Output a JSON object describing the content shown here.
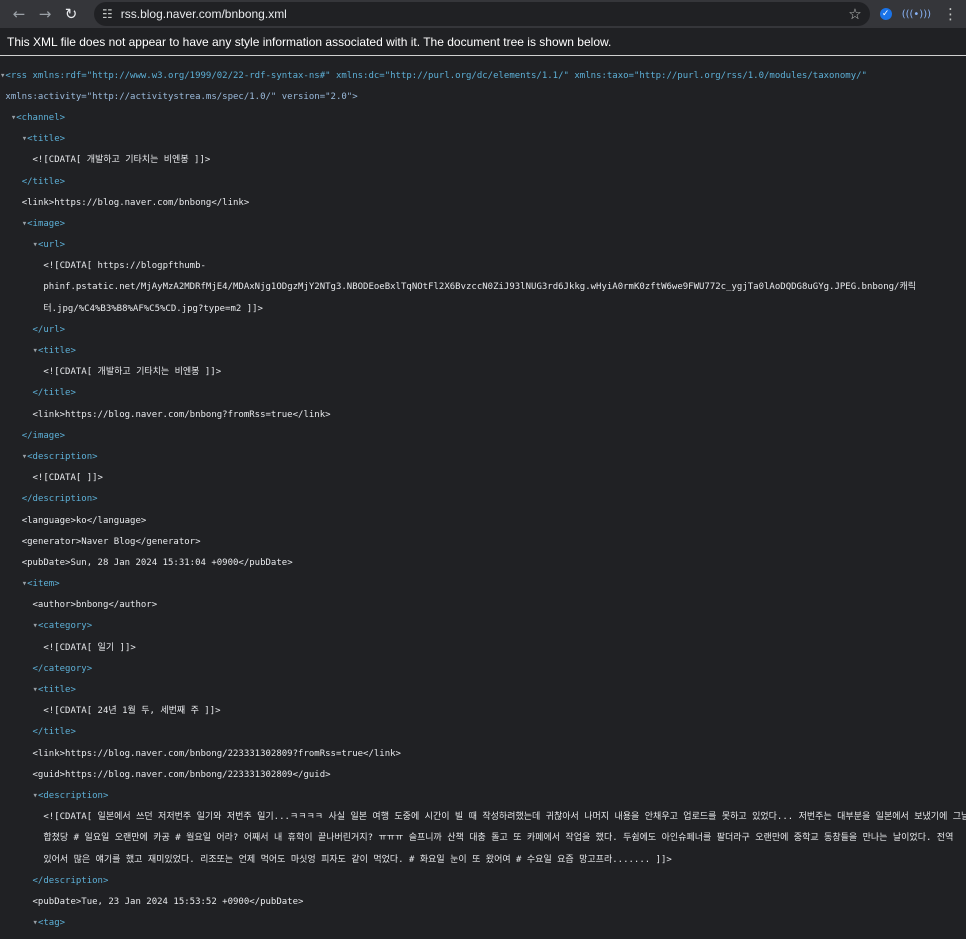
{
  "browser": {
    "url": "rss.blog.naver.com/bnbong.xml",
    "icons": [
      "back-icon",
      "forward-icon",
      "reload-icon",
      "site-info-icon",
      "star-icon",
      "extension-icon",
      "extension-icon",
      "menu-icon"
    ]
  },
  "notice": "This XML file does not appear to have any style information associated with it. The document tree is shown below.",
  "xml": {
    "rss_open_1": "<rss xmlns:rdf=\"http://www.w3.org/1999/02/22-rdf-syntax-ns#\" xmlns:dc=\"http://purl.org/dc/elements/1.1/\" xmlns:taxo=\"http://purl.org/rss/1.0/modules/taxonomy/\"",
    "rss_open_2": "xmlns:activity=\"http://activitystrea.ms/spec/1.0/\" version=\"2.0\">",
    "channel_open": "<channel>",
    "title_open": "<title>",
    "title_cdata": "<![CDATA[ 개발하고 기타치는 비엔봉 ]]>",
    "title_close": "</title>",
    "link": "<link>https://blog.naver.com/bnbong</link>",
    "image_open": "<image>",
    "url_open": "<url>",
    "url_cdata_1": "<![CDATA[ https://blogpfthumb-",
    "url_cdata_2": "phinf.pstatic.net/MjAyMzA2MDRfMjE4/MDAxNjg1ODgzMjY2NTg3.NBODEoeBxlTqNOtFl2X6BvzccN0ZiJ93lNUG3rd6Jkkg.wHyiA0rmK0zftW6we9FWU772c_ygjTa0lAoDQDG8uGYg.JPEG.bnbong/캐릭",
    "url_cdata_3": "터.jpg/%C4%B3%B8%AF%C5%CD.jpg?type=m2 ]]>",
    "url_close": "</url>",
    "image_title_open": "<title>",
    "image_title_cdata": "<![CDATA[ 개발하고 기타치는 비엔봉 ]]>",
    "image_title_close": "</title>",
    "image_link": "<link>https://blog.naver.com/bnbong?fromRss=true</link>",
    "image_close": "</image>",
    "description_open": "<description>",
    "description_cdata": "<![CDATA[ ]]>",
    "description_close": "</description>",
    "language": "<language>ko</language>",
    "generator": "<generator>Naver Blog</generator>",
    "pubdate": "<pubDate>Sun, 28 Jan 2024 15:31:04 +0900</pubDate>",
    "item_open": "<item>",
    "author": "<author>bnbong</author>",
    "category_open": "<category>",
    "category_cdata": "<![CDATA[ 일기 ]]>",
    "category_close": "</category>",
    "item_title_open": "<title>",
    "item_title_cdata": "<![CDATA[ 24년 1월 두, 세번째 주 ]]>",
    "item_title_close": "</title>",
    "item_link": "<link>https://blog.naver.com/bnbong/223331302809?fromRss=true</link>",
    "item_guid": "<guid>https://blog.naver.com/bnbong/223331302809</guid>",
    "item_desc_open": "<description>",
    "item_desc_1": "<![CDATA[ 일본에서 쓰던 저저번주 일기와 저번주 일기...ㅋㅋㅋㅋ 사실 일본 여행 도중에 시간이 빌 때 작성하려했는데 귀찮아서 나머지 내용을 안채우고 업로드를 못하고 있었다... 저번주는 대부분을 일본에서 보냈기에 그날",
    "item_desc_2": "합쳤당 # 일요일 오랜만에 카공 # 월요일 어라? 어째서 내 휴학이 끝나버린거지? ㅠㅠㅠ 슬프니까 산책 대충 돌고 또 카페에서 작업을 했다. 두쉼에도 아인슈페너를 팔더라구 오랜만에 중학교 동창들을 만나는 날이었다. 전역",
    "item_desc_3": "있어서 많은 얘기를 했고 재미있었다. 리조또는 언제 먹어도 마싯엉 피자도 같이 먹었다. # 화요일 눈이 또 왔어여 # 수요일 요즘 망고프라....... ]]>",
    "item_desc_close": "</description>",
    "item_pubdate": "<pubDate>Tue, 23 Jan 2024 15:53:52 +0900</pubDate>",
    "tag_open": "<tag>"
  }
}
